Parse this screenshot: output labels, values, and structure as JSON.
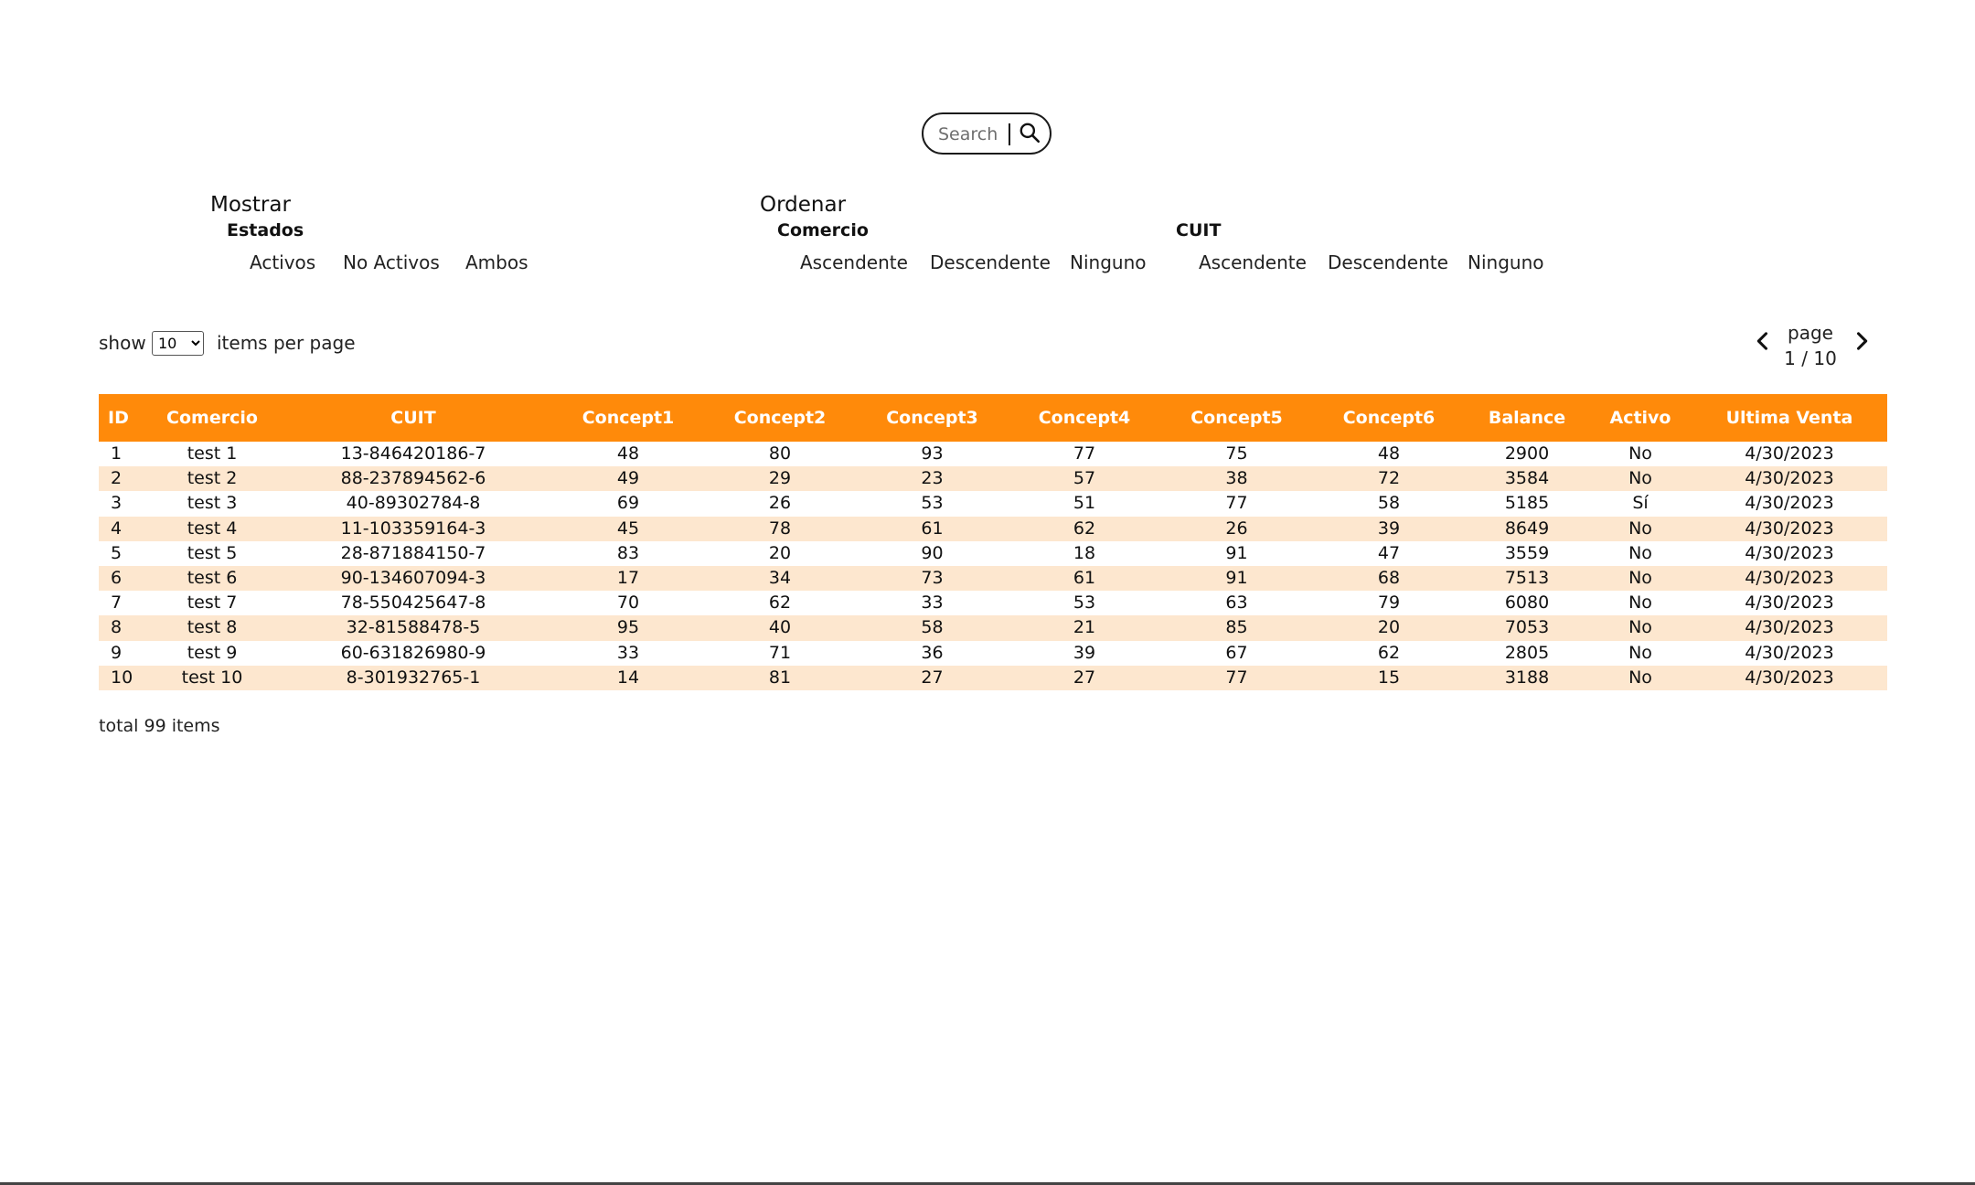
{
  "search": {
    "placeholder": "Search",
    "value": ""
  },
  "filters": {
    "mostrar": {
      "title": "Mostrar",
      "subtitle": "Estados",
      "options": [
        "Activos",
        "No Activos",
        "Ambos"
      ]
    },
    "ordenar": {
      "title": "Ordenar",
      "groups": [
        {
          "subtitle": "Comercio",
          "options": [
            "Ascendente",
            "Descendente",
            "Ninguno"
          ]
        },
        {
          "subtitle": "CUIT",
          "options": [
            "Ascendente",
            "Descendente",
            "Ninguno"
          ]
        }
      ]
    }
  },
  "pagination": {
    "show_label": "show",
    "per_page_value": "10",
    "per_page_options": [
      "10"
    ],
    "items_label": "items per page",
    "page_label": "page",
    "page_value": "1 / 10"
  },
  "table": {
    "columns": [
      "ID",
      "Comercio",
      "CUIT",
      "Concept1",
      "Concept2",
      "Concept3",
      "Concept4",
      "Concept5",
      "Concept6",
      "Balance",
      "Activo",
      "Ultima Venta"
    ],
    "rows": [
      [
        "1",
        "test 1",
        "13-846420186-7",
        "48",
        "80",
        "93",
        "77",
        "75",
        "48",
        "2900",
        "No",
        "4/30/2023"
      ],
      [
        "2",
        "test 2",
        "88-237894562-6",
        "49",
        "29",
        "23",
        "57",
        "38",
        "72",
        "3584",
        "No",
        "4/30/2023"
      ],
      [
        "3",
        "test 3",
        "40-89302784-8",
        "69",
        "26",
        "53",
        "51",
        "77",
        "58",
        "5185",
        "Sí",
        "4/30/2023"
      ],
      [
        "4",
        "test 4",
        "11-103359164-3",
        "45",
        "78",
        "61",
        "62",
        "26",
        "39",
        "8649",
        "No",
        "4/30/2023"
      ],
      [
        "5",
        "test 5",
        "28-871884150-7",
        "83",
        "20",
        "90",
        "18",
        "91",
        "47",
        "3559",
        "No",
        "4/30/2023"
      ],
      [
        "6",
        "test 6",
        "90-134607094-3",
        "17",
        "34",
        "73",
        "61",
        "91",
        "68",
        "7513",
        "No",
        "4/30/2023"
      ],
      [
        "7",
        "test 7",
        "78-550425647-8",
        "70",
        "62",
        "33",
        "53",
        "63",
        "79",
        "6080",
        "No",
        "4/30/2023"
      ],
      [
        "8",
        "test 8",
        "32-81588478-5",
        "95",
        "40",
        "58",
        "21",
        "85",
        "20",
        "7053",
        "No",
        "4/30/2023"
      ],
      [
        "9",
        "test 9",
        "60-631826980-9",
        "33",
        "71",
        "36",
        "39",
        "67",
        "62",
        "2805",
        "No",
        "4/30/2023"
      ],
      [
        "10",
        "test 10",
        "8-301932765-1",
        "14",
        "81",
        "27",
        "27",
        "77",
        "15",
        "3188",
        "No",
        "4/30/2023"
      ]
    ]
  },
  "footer": {
    "total_label": "total 99 items"
  },
  "colors": {
    "header_bg": "#ff8a0a",
    "stripe_bg": "#fde7cf"
  },
  "icons": {
    "search": "search-icon",
    "prev": "chevron-left-icon",
    "next": "chevron-right-icon"
  }
}
